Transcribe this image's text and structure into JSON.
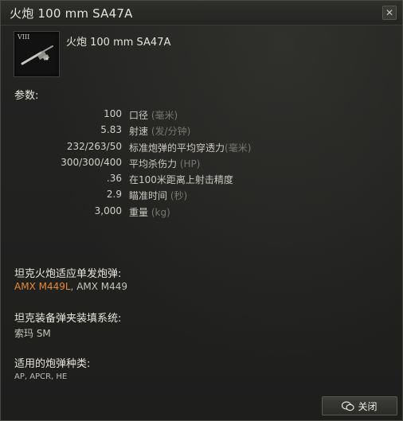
{
  "window": {
    "title": "火炮 100 mm SA47A",
    "close_label": "✕"
  },
  "module": {
    "tier": "VIII",
    "name": "火炮 100 mm SA47A"
  },
  "params": {
    "heading": "参数:",
    "rows": [
      {
        "value": "100",
        "label": "口径",
        "unit": "(毫米)"
      },
      {
        "value": "5.83",
        "label": "射速",
        "unit": "(发/分钟)"
      },
      {
        "value": "232/263/50",
        "label": "标准炮弹的平均穿透力",
        "unit": "(毫米)"
      },
      {
        "value": "300/300/400",
        "label": "平均杀伤力",
        "unit": "(HP)"
      },
      {
        "value": ".36",
        "label": "在100米距离上射击精度",
        "unit": ""
      },
      {
        "value": "2.9",
        "label": "瞄准时间",
        "unit": "(秒)"
      },
      {
        "value": "3,000",
        "label": "重量",
        "unit": "(kg)"
      }
    ]
  },
  "sections": {
    "single_shot_heading": "坦克火炮适应单发炮弹:",
    "single_shot_tanks": [
      "AMX M449L",
      "AMX M449"
    ],
    "single_shot_sep": ", ",
    "autoloader_heading": "坦克装备弹夹装填系统:",
    "autoloader_tanks": "索玛 SM",
    "ammo_heading": "适用的炮弹种类:",
    "ammo_types": "AP, APCR, HE"
  },
  "footer": {
    "button_label": "关闭"
  },
  "colors": {
    "accent_orange": "#e48a2f",
    "background": "#1e1e1d",
    "text": "#d2d0c8",
    "muted_unit": "#77766f"
  },
  "icons": {
    "close": "close-icon",
    "gun": "gun-icon",
    "button": "wechat-icon"
  }
}
